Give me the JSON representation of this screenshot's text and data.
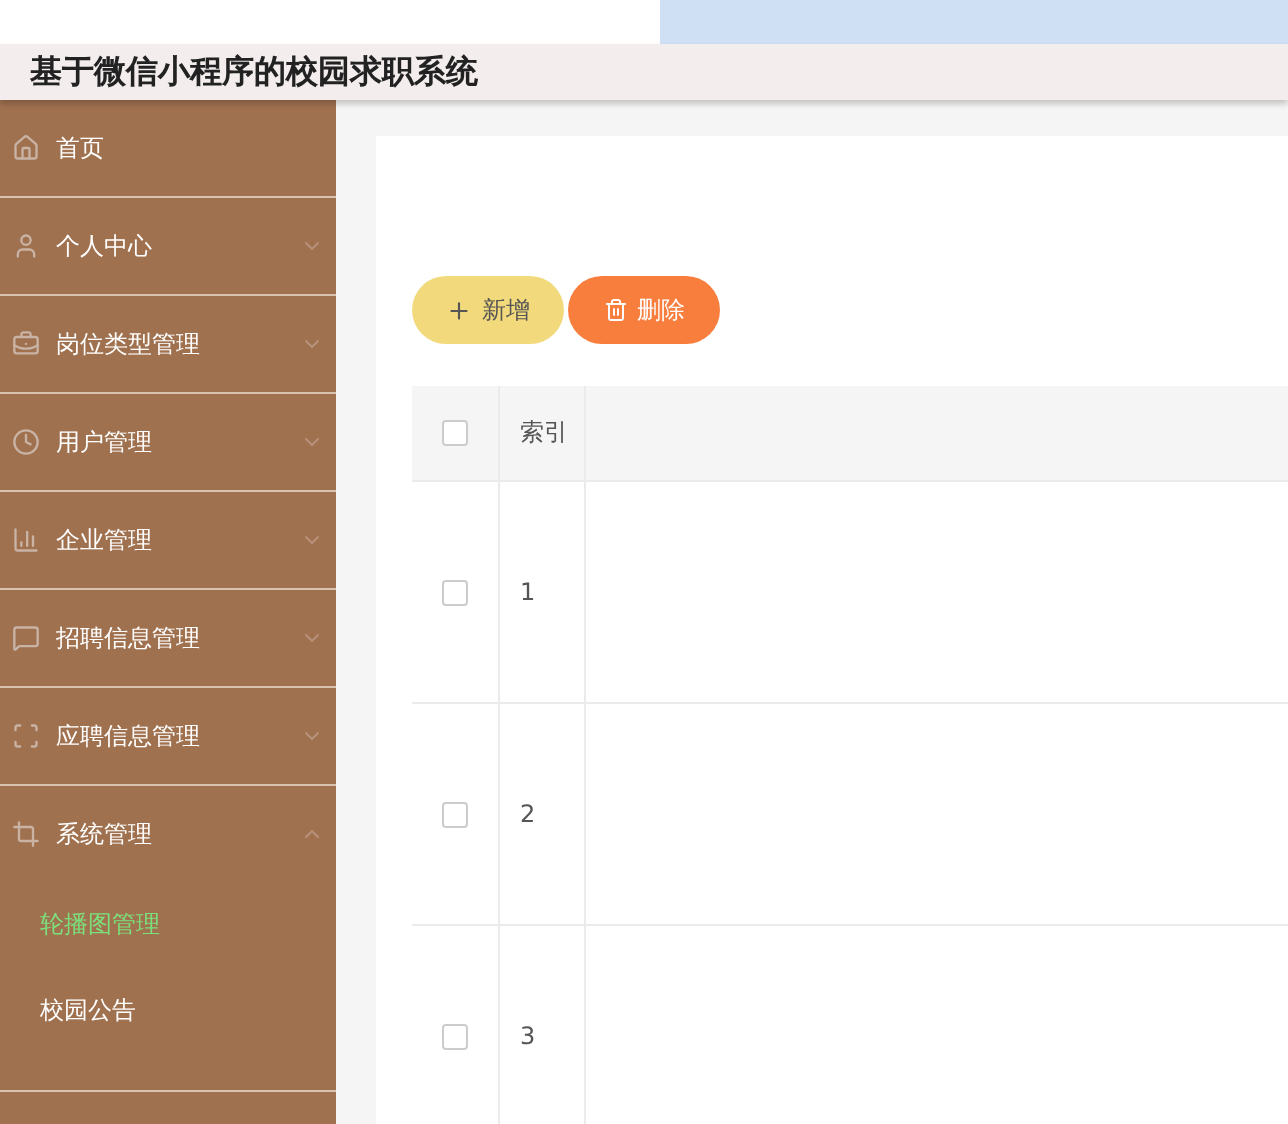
{
  "header": {
    "title": "基于微信小程序的校园求职系统"
  },
  "sidebar": {
    "items": [
      {
        "label": "首页"
      },
      {
        "label": "个人中心",
        "expanded": false
      },
      {
        "label": "岗位类型管理",
        "expanded": false
      },
      {
        "label": "用户管理",
        "expanded": false
      },
      {
        "label": "企业管理",
        "expanded": false
      },
      {
        "label": "招聘信息管理",
        "expanded": false
      },
      {
        "label": "应聘信息管理",
        "expanded": false
      },
      {
        "label": "系统管理",
        "expanded": true,
        "children": [
          {
            "label": "轮播图管理",
            "selected": true
          },
          {
            "label": "校园公告",
            "selected": false
          }
        ]
      }
    ]
  },
  "toolbar": {
    "buttons": [
      {
        "label": "新增",
        "kind": "add"
      },
      {
        "label": "删除",
        "kind": "delete"
      }
    ]
  },
  "table": {
    "columns": [
      {
        "label": "索引"
      }
    ],
    "header_checked": false,
    "rows": [
      {
        "index": "1",
        "checked": false
      },
      {
        "index": "2",
        "checked": false
      },
      {
        "index": "3",
        "checked": false
      }
    ]
  }
}
